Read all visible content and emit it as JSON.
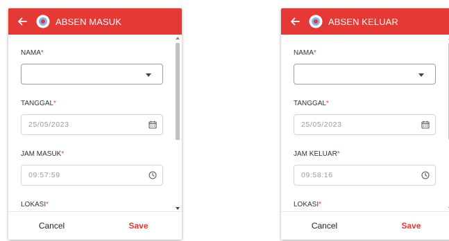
{
  "colors": {
    "accent": "#e53935",
    "field_border": "#d5d5d5",
    "text": "#333333"
  },
  "icons": {
    "back": "arrow-left",
    "logo": "app-logo",
    "calendar": "calendar",
    "clock": "clock",
    "dropdown": "chevron-down"
  },
  "masuk": {
    "title": "ABSEN MASUK",
    "nama_label": "NAMA",
    "tanggal_label": "TANGGAL",
    "tanggal_value": "25/05/2023",
    "jam_label": "JAM MASUK",
    "jam_value": "09:57:59",
    "lokasi_label": "LOKASI",
    "required_mark": "*",
    "cancel_label": "Cancel",
    "save_label": "Save"
  },
  "keluar": {
    "title": "ABSEN KELUAR",
    "nama_label": "NAMA",
    "tanggal_label": "TANGGAL",
    "tanggal_value": "25/05/2023",
    "jam_label": "JAM KELUAR",
    "jam_value": "09:58:16",
    "lokasi_label": "LOKASI",
    "required_mark": "*",
    "cancel_label": "Cancel",
    "save_label": "Save"
  }
}
